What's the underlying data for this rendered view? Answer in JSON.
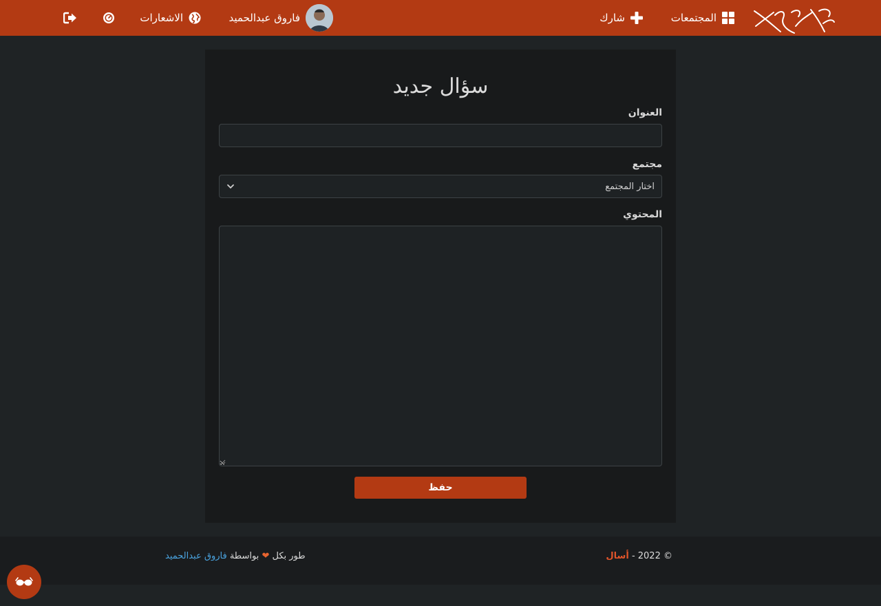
{
  "nav": {
    "communities_label": "المجتمعات",
    "share_label": "شارك",
    "user_name": "فاروق عبدالحميد",
    "notifications_label": "الاشعارات"
  },
  "form": {
    "heading": "سؤال جديد",
    "title_label": "العنوان",
    "title_value": "",
    "community_label": "مجتمع",
    "community_selected": "اختار المجتمع",
    "content_label": "المحتوي",
    "content_value": "",
    "save_label": "حفظ"
  },
  "footer": {
    "made_with": "طور بكل",
    "by": "بواسطة",
    "developer": "فاروق عبدالحميد",
    "copyright": "© 2022 -",
    "brand": "أسال"
  },
  "colors": {
    "accent": "#b33a13",
    "background": "#1f2325",
    "card": "#181a1b",
    "link": "#4aa3df"
  },
  "icons": {
    "communities": "grid-icon",
    "share": "plus-icon",
    "notifications": "globe-icon",
    "dashboard": "gauge-icon",
    "logout": "logout-icon",
    "float": "glasses-icon"
  }
}
